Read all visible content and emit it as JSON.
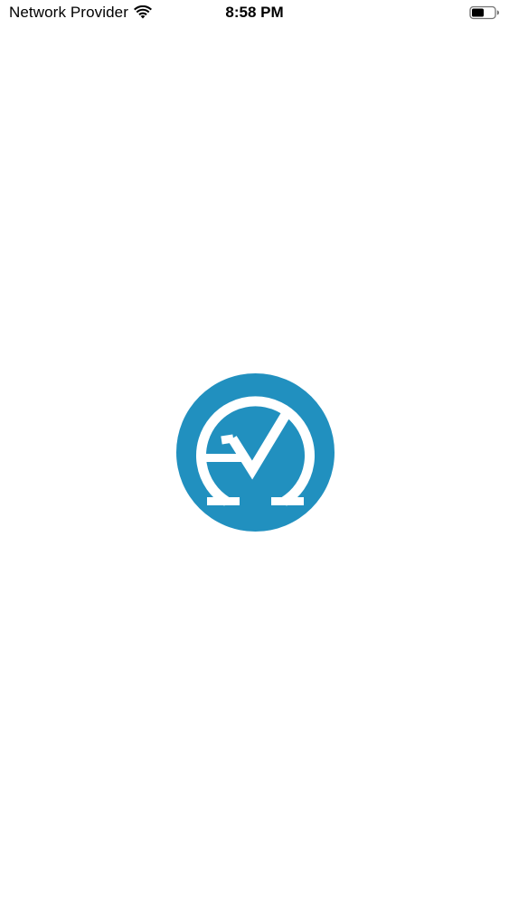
{
  "status_bar": {
    "carrier": "Network Provider",
    "time": "8:58 PM",
    "wifi_icon": "wifi-icon",
    "battery_icon": "battery-icon"
  },
  "splash": {
    "logo_icon": "app-logo-icon",
    "logo_color": "#2190bf",
    "background_color": "#ffffff"
  }
}
